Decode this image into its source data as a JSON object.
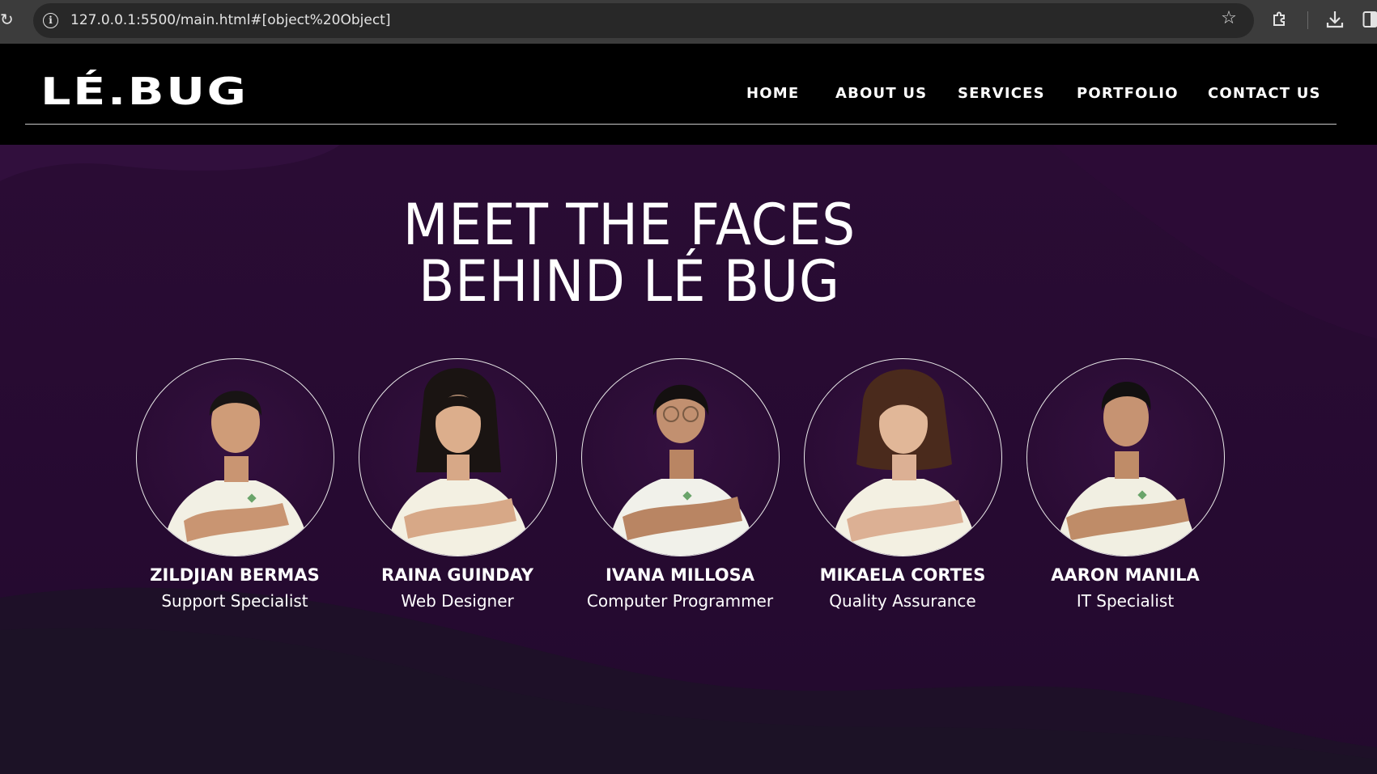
{
  "browser": {
    "url": "127.0.0.1:5500/main.html#[object%20Object]",
    "reload_icon": "reload-icon",
    "site_info_icon": "info-icon",
    "bookmark_icon": "star-icon",
    "extensions_icon": "puzzle-icon",
    "download_icon": "download-icon",
    "side_panel_icon": "side-panel-icon"
  },
  "header": {
    "logo": "LÉ.BUG",
    "nav": {
      "home": "HOME",
      "about": "ABOUT US",
      "services": "SERVICES",
      "portfolio": "PORTFOLIO",
      "contact": "CONTACT US"
    }
  },
  "team": {
    "title_line1": "MEET THE FACES",
    "title_line2": "BEHIND LÉ BUG",
    "members": [
      {
        "name": "ZILDJIAN BERMAS",
        "role": "Support Specialist"
      },
      {
        "name": "RAINA GUINDAY",
        "role": "Web Designer"
      },
      {
        "name": "IVANA MILLOSA",
        "role": "Computer Programmer"
      },
      {
        "name": "MIKAELA CORTES",
        "role": "Quality Assurance"
      },
      {
        "name": "AARON MANILA",
        "role": "IT Specialist"
      }
    ]
  },
  "colors": {
    "chrome": "#3c3c3c",
    "omnibox": "#282828",
    "header_bg": "#000000",
    "section_bg": "#2a0c34",
    "wave_dark": "#1c1226",
    "text": "#ffffff"
  }
}
